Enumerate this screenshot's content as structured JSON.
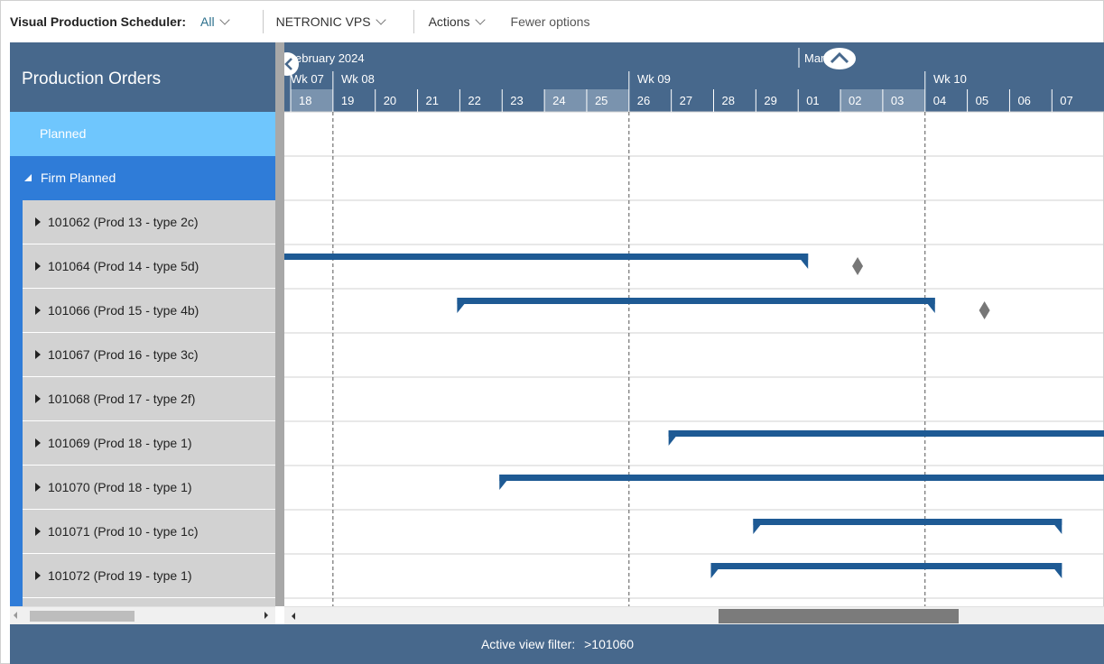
{
  "toolbar": {
    "title": "Visual Production Scheduler:",
    "filter_value": "All",
    "scheduler_name": "NETRONIC VPS",
    "actions_label": "Actions",
    "fewer_options_label": "Fewer options"
  },
  "left_panel": {
    "header": "Production Orders",
    "groups": {
      "planned": "Planned",
      "firm_planned": "Firm Planned"
    },
    "orders": [
      "101062 (Prod 13 - type 2c)",
      "101064 (Prod 14 - type 5d)",
      "101066 (Prod 15 - type 4b)",
      "101067 (Prod 16 - type 3c)",
      "101068 (Prod 17 - type 2f)",
      "101069 (Prod 18 - type 1)",
      "101070 (Prod 18 - type 1)",
      "101071 (Prod 10 - type 1c)",
      "101072 (Prod 19 - type 1)"
    ]
  },
  "timeline": {
    "months": [
      "ebruary 2024",
      "Mar  024"
    ],
    "weeks": [
      "Wk 07",
      "Wk 08",
      "Wk 09",
      "Wk 10"
    ],
    "days": [
      "18",
      "19",
      "20",
      "21",
      "22",
      "23",
      "24",
      "25",
      "26",
      "27",
      "28",
      "29",
      "01",
      "02",
      "03",
      "04",
      "05",
      "06",
      "07"
    ],
    "weekend_days": [
      "18",
      "24",
      "25",
      "02",
      "03"
    ]
  },
  "gantt_bars": [
    {
      "order": "101064 (Prod 14 - type 5d)",
      "start_day": "18",
      "end_day": "01",
      "clipped_left": true,
      "milestone_day": "02"
    },
    {
      "order": "101066 (Prod 15 - type 4b)",
      "start_day": "22",
      "end_day": "04",
      "milestone_day": "05"
    },
    {
      "order": "101069 (Prod 18 - type 1)",
      "start_day": "27",
      "end_day": "07",
      "clipped_right": true
    },
    {
      "order": "101070 (Prod 18 - type 1)",
      "start_day": "23",
      "end_day": "07",
      "clipped_right": true
    },
    {
      "order": "101071 (Prod 10 - type 1c)",
      "start_day": "29",
      "end_day": "07"
    },
    {
      "order": "101072 (Prod 19 - type 1)",
      "start_day": "28",
      "end_day": "07"
    }
  ],
  "footer": {
    "label": "Active view filter:",
    "value": ">101060"
  },
  "colors": {
    "header_blue": "#47688c",
    "planned": "#6fc6fd",
    "firm_planned": "#2f7cd8",
    "bar": "#1e5a94",
    "milestone": "#777777",
    "weekend_cell": "#7a93ae"
  }
}
